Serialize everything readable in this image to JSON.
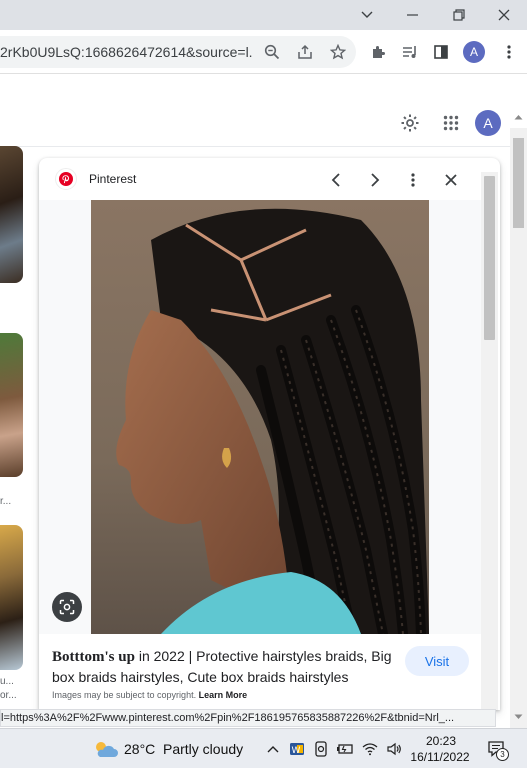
{
  "browser": {
    "url": "2rKb0U9LsQ:1668626472614&source=l...",
    "profile_initial": "A"
  },
  "google": {
    "profile_initial": "A"
  },
  "thumbnails": {
    "caption_1": "r...",
    "caption_2": "u...",
    "caption_3": "or..."
  },
  "preview": {
    "source": "Pinterest",
    "title_bold": "Botttom's up",
    "title_rest": " in 2022 | Protective hairstyles braids, Big box braids hairstyles, Cute box braids hairstyles",
    "visit_label": "Visit",
    "copyright_note": "Images may be subject to copyright.",
    "learn_more": "Learn More"
  },
  "status_url": "l=https%3A%2F%2Fwww.pinterest.com%2Fpin%2F186195765835887226%2F&tbnid=Nrl_...",
  "taskbar": {
    "temperature": "28°C",
    "weather": "Partly cloudy",
    "time": "20:23",
    "date": "16/11/2022",
    "notifications": "3"
  },
  "colors": {
    "accent": "#1a73e8",
    "pinterest_red": "#e60023",
    "avatar": "#5c6bc0"
  }
}
